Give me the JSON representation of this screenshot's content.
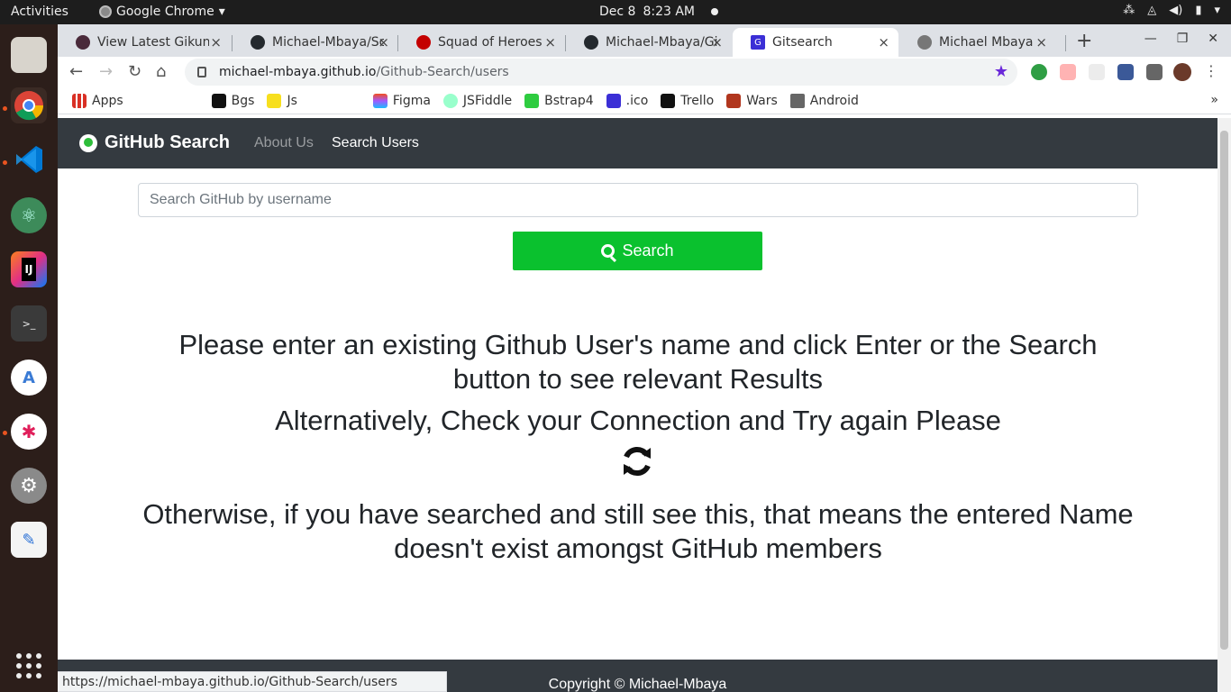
{
  "system": {
    "activities": "Activities",
    "app_name": "Google Chrome",
    "date": "Dec 8",
    "time": "8:23 AM"
  },
  "tabs": [
    {
      "title": "View Latest Gikundi",
      "close": "×"
    },
    {
      "title": "Michael-Mbaya/Sc",
      "close": "×"
    },
    {
      "title": "Squad of Heroes",
      "close": "×"
    },
    {
      "title": "Michael-Mbaya/Gi",
      "close": "×"
    },
    {
      "title": "Gitsearch",
      "close": "×",
      "active": true
    },
    {
      "title": "Michael Mbaya",
      "close": "×"
    }
  ],
  "address_bar": {
    "host": "michael-mbaya.github.io",
    "path": "/Github-Search/users"
  },
  "bookmarks": [
    "Apps",
    "Bgs",
    "Js",
    "Figma",
    "JSFiddle",
    "Bstrap4",
    ".ico",
    "Trello",
    "Wars",
    "Android"
  ],
  "navbar": {
    "brand": "GitHub Search",
    "about": "About Us",
    "search_users": "Search Users"
  },
  "search": {
    "placeholder": "Search GitHub by username",
    "button_label": "Search"
  },
  "messages": {
    "line1": "Please enter an existing Github User's name and click Enter or the Search button to see relevant Results",
    "line2": "Alternatively, Check your Connection and Try again Please",
    "line3": "Otherwise, if you have searched and still see this, that means the entered Name doesn't exist amongst GitHub members"
  },
  "footer": {
    "copyright": "Copyright © Michael-Mbaya"
  },
  "status_url": "https://michael-mbaya.github.io/Github-Search/users",
  "colors": {
    "navbar_bg": "#343a40",
    "search_button": "#0ac12e",
    "brand_accent": "#2dbd3a"
  }
}
